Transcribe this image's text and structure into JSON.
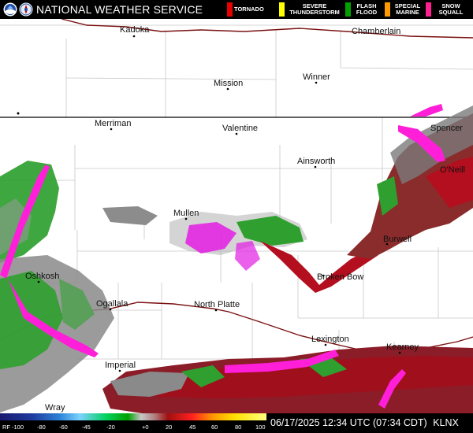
{
  "header": {
    "title": "NATIONAL WEATHER SERVICE",
    "legend": [
      {
        "label": "TORNADO",
        "color": "#e60000"
      },
      {
        "label": "SEVERE THUNDERSTORM",
        "color": "#ffff00"
      },
      {
        "label": "FLASH FLOOD",
        "color": "#00a000"
      },
      {
        "label": "SPECIAL MARINE",
        "color": "#ff9900"
      },
      {
        "label": "SNOW SQUALL",
        "color": "#ff1f8f"
      }
    ]
  },
  "map": {
    "cities": [
      "Kadoka",
      "Chamberlain",
      "Mission",
      "Winner",
      "Merriman",
      "Valentine",
      "Spencer",
      "Ainsworth",
      "O'Neill",
      "Mullen",
      "Burwell",
      "Oshkosh",
      "Broken Bow",
      "Ogallala",
      "North Platte",
      "Lexington",
      "Kearney",
      "Imperial",
      "Wray"
    ]
  },
  "colorbar": {
    "unit_label": "RF",
    "tick_labels": [
      "-100",
      "-80",
      "-60",
      "-45",
      "-20",
      "+0",
      "20",
      "45",
      "60",
      "80",
      "100"
    ]
  },
  "footer": {
    "timestamp": "06/17/2025 12:34 UTC (07:34 CDT)",
    "station": "KLNX"
  }
}
